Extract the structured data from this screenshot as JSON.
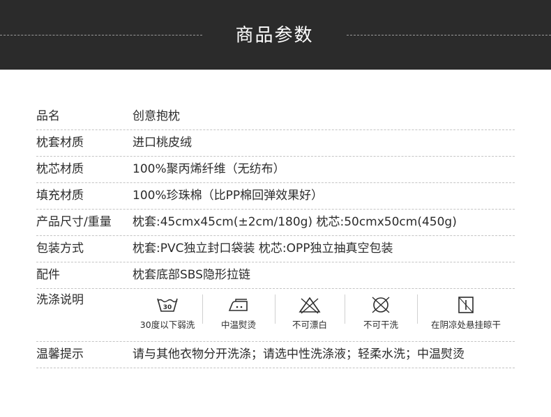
{
  "header": {
    "title": "商品参数"
  },
  "rows": [
    {
      "label": "品名",
      "value": "创意抱枕"
    },
    {
      "label": "枕套材质",
      "value": "进口桃皮绒"
    },
    {
      "label": "枕芯材质",
      "value": "100%聚丙烯纤维（无纺布）"
    },
    {
      "label": "填充材质",
      "value": "100%珍珠棉（比PP棉回弹效果好）"
    },
    {
      "label": "产品尺寸/重量",
      "value": "枕套:45cmx45cm(±2cm/180g)  枕芯:50cmx50cm(450g)"
    },
    {
      "label": "包装方式",
      "value": "枕套:PVC独立封口袋装 枕芯:OPP独立抽真空包装"
    },
    {
      "label": "配件",
      "value": "枕套底部SBS隐形拉链"
    }
  ],
  "wash": {
    "label": "洗涤说明",
    "icons": [
      {
        "icon": "wash-30-icon",
        "number": "30",
        "caption": "30度以下弱洗"
      },
      {
        "icon": "iron-medium-icon",
        "caption": "中温熨烫"
      },
      {
        "icon": "no-bleach-icon",
        "caption": "不可漂白"
      },
      {
        "icon": "no-dry-clean-icon",
        "caption": "不可干洗"
      },
      {
        "icon": "line-dry-shade-icon",
        "caption": "在阴凉处悬挂晾干"
      }
    ]
  },
  "tip": {
    "label": "温馨提示",
    "value": "请与其他衣物分开洗涤；请选中性洗涤液；轻柔水洗；中温熨烫"
  }
}
